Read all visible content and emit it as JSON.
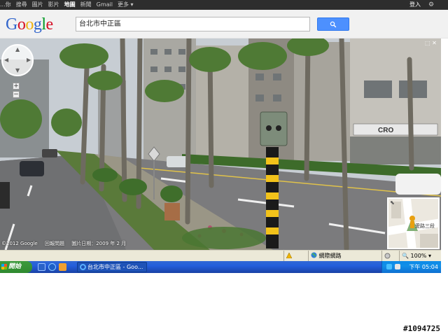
{
  "gbar": {
    "nav": [
      "...你",
      "搜尋",
      "圖片",
      "影片",
      "地圖",
      "新聞",
      "Gmail",
      "更多 ▾"
    ],
    "active_index": 4,
    "signin": "登入",
    "gear": "⚙"
  },
  "header": {
    "logo": [
      "G",
      "o",
      "o",
      "g",
      "l",
      "e"
    ],
    "logo_colors": [
      "#3366cc",
      "#d50f25",
      "#eeb211",
      "#3366cc",
      "#009925",
      "#d50f25"
    ],
    "search_value": "台北市中正區",
    "search_icon": "search-icon"
  },
  "streetview": {
    "nav_control_icon": "pan-control-icon",
    "zoom_in": "+",
    "zoom_out": "−",
    "maximize_icon": "⬚ ✕",
    "mini_map_label": "愛路三段",
    "mini_map_expand": "⬉",
    "footer": [
      "©2012 Google",
      "回報問題",
      "圖片日期：2009 年 2 月"
    ]
  },
  "statusbar": {
    "zone": "網際網路",
    "zoom": "100%"
  },
  "taskbar": {
    "start": "開始",
    "task_item": "台北市中正區 - Goo...",
    "clock": "下午 05:04"
  },
  "watermark": "#1094725"
}
